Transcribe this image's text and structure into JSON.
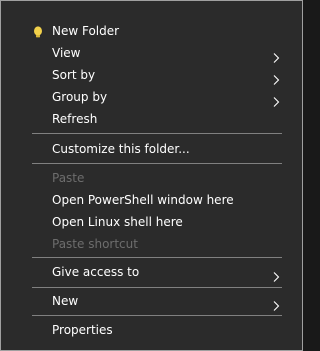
{
  "context_menu": {
    "items": [
      {
        "label": "New Folder",
        "icon": "bulb-icon",
        "submenu": false,
        "disabled": false
      },
      {
        "label": "View",
        "submenu": true,
        "disabled": false
      },
      {
        "label": "Sort by",
        "submenu": true,
        "disabled": false
      },
      {
        "label": "Group by",
        "submenu": true,
        "disabled": false
      },
      {
        "label": "Refresh",
        "submenu": false,
        "disabled": false
      },
      {
        "label": "Customize this folder...",
        "submenu": false,
        "disabled": false
      },
      {
        "label": "Paste",
        "submenu": false,
        "disabled": true
      },
      {
        "label": "Open PowerShell window here",
        "submenu": false,
        "disabled": false
      },
      {
        "label": "Open Linux shell here",
        "submenu": false,
        "disabled": false
      },
      {
        "label": "Paste shortcut",
        "submenu": false,
        "disabled": true
      },
      {
        "label": "Give access to",
        "submenu": true,
        "disabled": false
      },
      {
        "label": "New",
        "submenu": true,
        "disabled": false
      },
      {
        "label": "Properties",
        "submenu": false,
        "disabled": false
      }
    ]
  },
  "colors": {
    "menu_background": "#2b2b2b",
    "menu_border": "#a0a0a0",
    "text": "#ffffff",
    "disabled_text": "#6d6d6d",
    "separator": "#808080",
    "icon_yellow": "#f2d14b"
  }
}
